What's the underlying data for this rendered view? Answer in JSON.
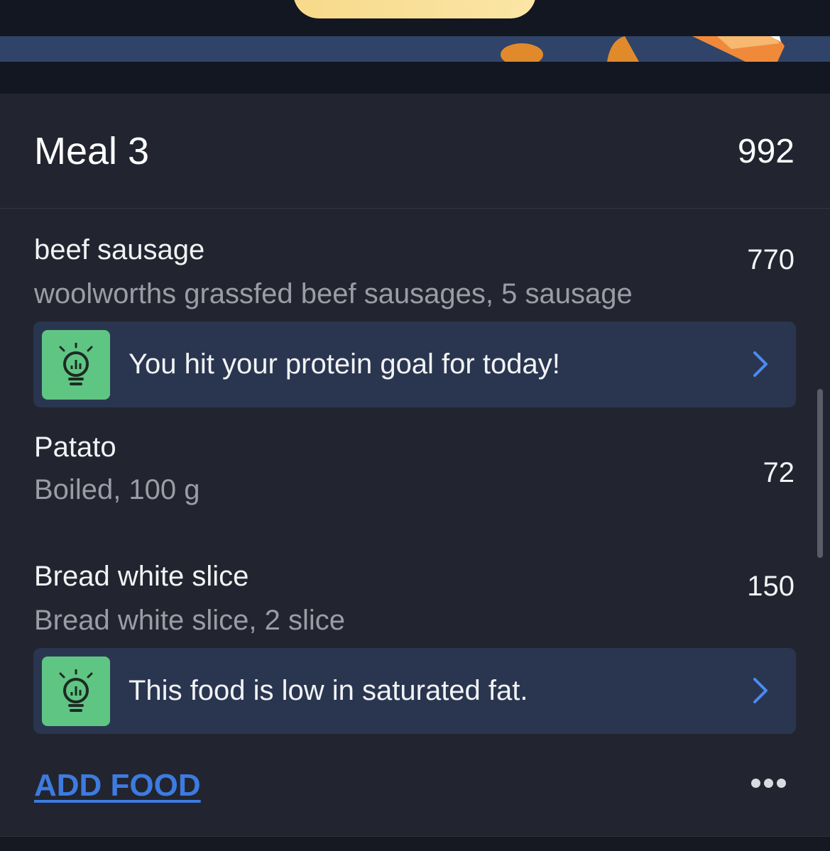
{
  "meal": {
    "title": "Meal 3",
    "total_calories": "992",
    "items": [
      {
        "name": "beef sausage",
        "description": "woolworths grassfed beef sausages, 5 sausage",
        "calories": "770",
        "tip": {
          "text": "You hit your protein goal for today!",
          "icon": "lightbulb-chart-icon"
        }
      },
      {
        "name": "Patato",
        "description": "Boiled, 100 g",
        "calories": "72"
      },
      {
        "name": "Bread white slice",
        "description": "Bread white slice, 2 slice",
        "calories": "150",
        "tip": {
          "text": "This food is low in saturated fat.",
          "icon": "lightbulb-chart-icon"
        }
      }
    ],
    "add_food_label": "ADD FOOD",
    "more_icon": "more-options-icon"
  },
  "colors": {
    "background": "#22252f",
    "tip_background": "#2a3650",
    "tip_icon_background": "#5fc583",
    "accent_link": "#3d7be0",
    "chevron": "#4a8cf0"
  }
}
